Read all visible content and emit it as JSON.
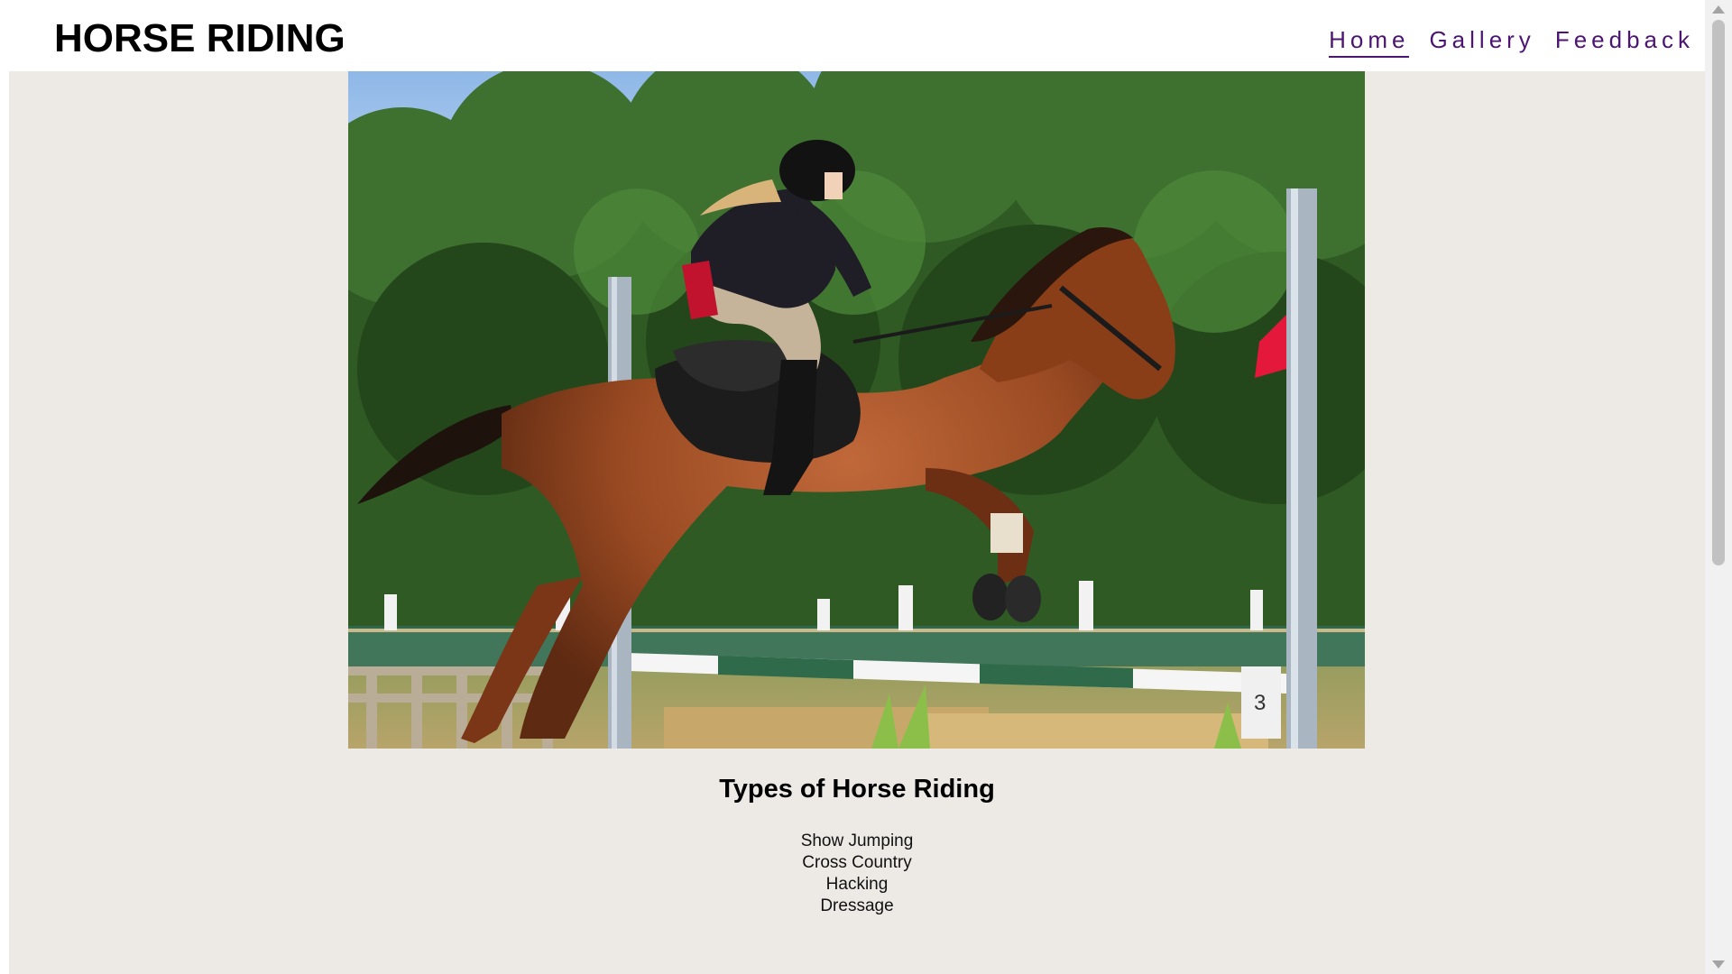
{
  "header": {
    "site_title": "HORSE RIDING"
  },
  "nav": {
    "items": [
      {
        "label": "Home",
        "active": true
      },
      {
        "label": "Gallery",
        "active": false
      },
      {
        "label": "Feedback",
        "active": false
      }
    ]
  },
  "main": {
    "hero_image": {
      "icon": "horse-show-jumping-photo"
    },
    "section_title": "Types of Horse Riding",
    "riding_types": [
      "Show Jumping",
      "Cross Country",
      "Hacking",
      "Dressage"
    ]
  },
  "colors": {
    "nav_link": "#4b1571",
    "content_background": "#edeae6",
    "header_background": "#ffffff"
  }
}
